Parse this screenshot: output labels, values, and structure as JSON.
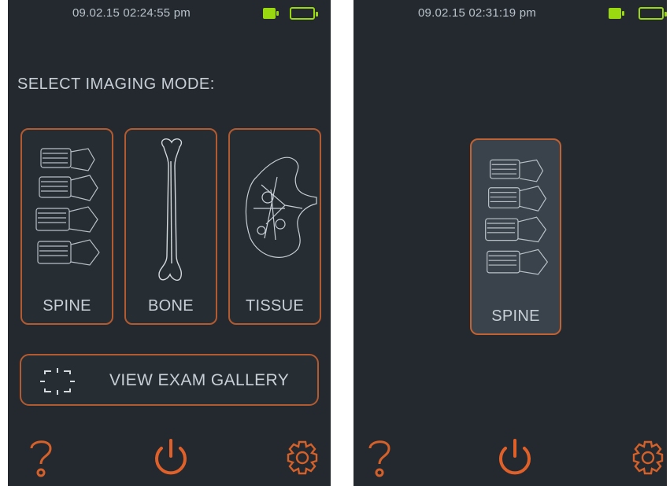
{
  "screens": [
    {
      "status": {
        "datetime": "09.02.15  02:24:55 pm"
      },
      "heading": "SELECT IMAGING MODE:",
      "modes": [
        {
          "label": "SPINE",
          "icon": "spine-icon"
        },
        {
          "label": "BONE",
          "icon": "bone-icon"
        },
        {
          "label": "TISSUE",
          "icon": "kidney-icon"
        }
      ],
      "gallery_button": {
        "label": "VIEW EXAM GALLERY",
        "icon": "focus-frame-icon"
      },
      "bottom_icons": [
        "help-icon",
        "power-icon",
        "gear-icon"
      ]
    },
    {
      "status": {
        "datetime": "09.02.15  02:31:19 pm"
      },
      "selected_mode": {
        "label": "SPINE",
        "icon": "spine-icon"
      },
      "bottom_icons": [
        "help-icon",
        "power-icon",
        "gear-icon"
      ]
    }
  ],
  "colors": {
    "background": "#23292f",
    "accent": "#d4602a",
    "tile_border": "#b35a30",
    "text": "#c8cfd6",
    "battery": "#9ad80f",
    "selected_tile": "#3a434b"
  }
}
